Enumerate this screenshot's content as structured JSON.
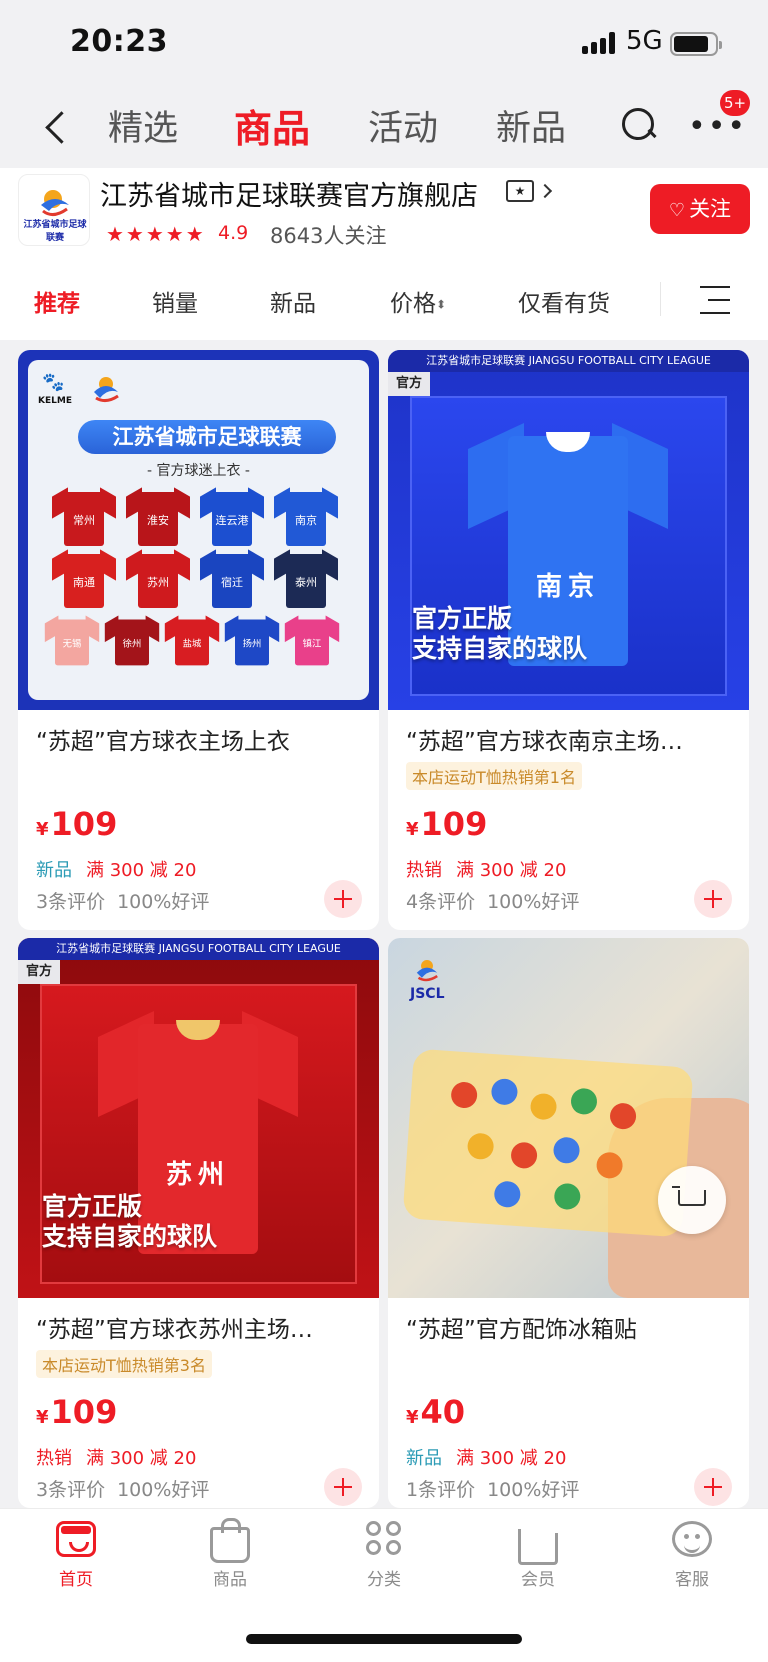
{
  "status": {
    "time": "20:23",
    "network": "5G"
  },
  "topnav": {
    "tabs": [
      "精选",
      "商品",
      "活动",
      "新品"
    ],
    "active_tab": "商品",
    "badge": "5+"
  },
  "shop": {
    "name": "江苏省城市足球联赛官方旗舰店",
    "rating": "4.9",
    "followers": "8643人关注",
    "follow_label": "关注",
    "logo_text": "江苏省城市足球联赛"
  },
  "filters": {
    "items": [
      "推荐",
      "销量",
      "新品",
      "价格",
      "仅看有货"
    ]
  },
  "products": [
    {
      "title": "“苏超”官方球衣主场上衣",
      "tag": "",
      "currency": "¥",
      "price": "109",
      "label": "新品",
      "label_type": "new",
      "discount": "满 300 减 20",
      "reviews": "3条评价",
      "positive": "100%好评",
      "image": {
        "banner": "江苏省城市足球联赛",
        "sub": "- 官方球迷上衣 -",
        "brand": "KELME",
        "jerseys": [
          {
            "city": "常州",
            "color": "#c8191d"
          },
          {
            "city": "淮安",
            "color": "#b8151a"
          },
          {
            "city": "连云港",
            "color": "#1c4fd0"
          },
          {
            "city": "南京",
            "color": "#2159d6"
          },
          {
            "city": "南通",
            "color": "#d8201f"
          },
          {
            "city": "苏州",
            "color": "#cf1a1e"
          },
          {
            "city": "宿迁",
            "color": "#1a45c0"
          },
          {
            "city": "泰州",
            "color": "#1c2a55"
          },
          {
            "city": "无锡",
            "color": "#f3a6a0"
          },
          {
            "city": "徐州",
            "color": "#a3141a"
          },
          {
            "city": "盐城",
            "color": "#d81d22"
          },
          {
            "city": "扬州",
            "color": "#1e48c6"
          },
          {
            "city": "镇江",
            "color": "#e9408a"
          }
        ]
      }
    },
    {
      "title": "“苏超”官方球衣南京主场…",
      "tag": "本店运动T恤热销第1名",
      "currency": "¥",
      "price": "109",
      "label": "热销",
      "label_type": "hot",
      "discount": "满 300 减 20",
      "reviews": "4条评价",
      "positive": "100%好评",
      "image": {
        "strip": "江苏省城市足球联赛 JIANGSU FOOTBALL CITY LEAGUE",
        "official": "官方",
        "city": "南京",
        "slogan1": "官方正版",
        "slogan2": "支持自家的球队"
      }
    },
    {
      "title": "“苏超”官方球衣苏州主场…",
      "tag": "本店运动T恤热销第3名",
      "currency": "¥",
      "price": "109",
      "label": "热销",
      "label_type": "hot",
      "discount": "满 300 减 20",
      "reviews": "3条评价",
      "positive": "100%好评",
      "image": {
        "strip": "江苏省城市足球联赛 JIANGSU FOOTBALL CITY LEAGUE",
        "official": "官方",
        "city": "苏州",
        "slogan1": "官方正版",
        "slogan2": "支持自家的球队"
      }
    },
    {
      "title": "“苏超”官方配饰冰箱贴",
      "tag": "",
      "currency": "¥",
      "price": "40",
      "label": "新品",
      "label_type": "new",
      "discount": "满 300 减 20",
      "reviews": "1条评价",
      "positive": "100%好评",
      "image": {
        "brand": "JSCL"
      }
    }
  ],
  "tabbar": {
    "items": [
      "首页",
      "商品",
      "分类",
      "会员",
      "客服"
    ],
    "active": "首页"
  },
  "colors": {
    "accent": "#ee1c25",
    "new_label": "#2b9bb5",
    "tag_bg": "#fdf2de"
  }
}
